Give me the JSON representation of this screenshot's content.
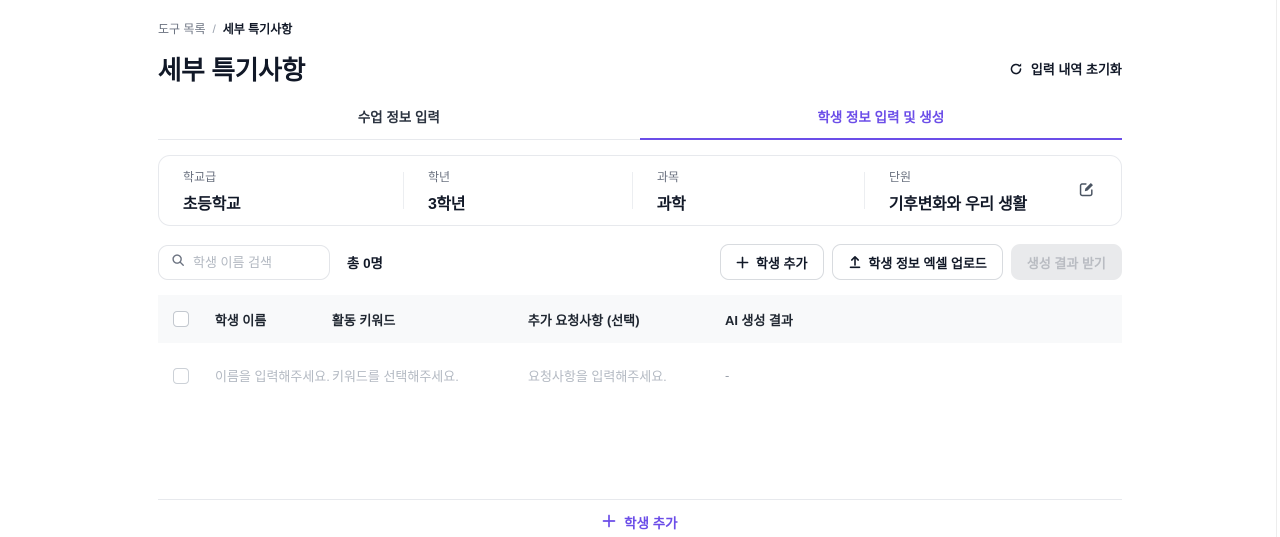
{
  "breadcrumb": {
    "parent": "도구 목록",
    "separator": "/",
    "current": "세부 특기사항"
  },
  "page_title": "세부 특기사항",
  "header": {
    "reset_label": "입력 내역 초기화",
    "reset_icon": "refresh-icon"
  },
  "tabs": [
    {
      "label": "수업 정보 입력",
      "active": false
    },
    {
      "label": "학생 정보 입력 및 생성",
      "active": true
    }
  ],
  "class_info": {
    "fields": [
      {
        "label": "학교급",
        "value": "초등학교"
      },
      {
        "label": "학년",
        "value": "3학년"
      },
      {
        "label": "과목",
        "value": "과학"
      },
      {
        "label": "단원",
        "value": "기후변화와 우리 생활"
      }
    ],
    "edit_icon": "edit-icon"
  },
  "toolbar": {
    "search_icon": "search-icon",
    "search_placeholder": "학생 이름 검색",
    "total_count": "총 0명",
    "add_student_label": "학생 추가",
    "add_student_icon": "plus-icon",
    "upload_label": "학생 정보 엑셀 업로드",
    "upload_icon": "upload-icon",
    "generate_label": "생성 결과 받기",
    "generate_disabled": true
  },
  "table": {
    "headers": [
      "학생 이름",
      "활동 키워드",
      "추가 요청사항 (선택)",
      "AI 생성 결과"
    ],
    "rows": [
      {
        "name_placeholder": "이름을 입력해주세요.",
        "keyword_placeholder": "키워드를 선택해주세요.",
        "request_placeholder": "요청사항을 입력해주세요.",
        "ai_result": "-"
      }
    ]
  },
  "footer": {
    "add_student_label": "학생 추가",
    "add_student_icon": "plus-icon"
  },
  "icons": {
    "refresh-icon": "⟳",
    "search-icon": "⌕",
    "plus-icon": "+",
    "upload-icon": "↥",
    "edit-icon": "✎"
  },
  "colors": {
    "accent_purple": "#6B4DE8",
    "text_dark": "#111827",
    "text_gray": "#6B7280",
    "placeholder_gray": "#B3B9C2",
    "border_gray": "#E7E9ED",
    "table_header_bg": "#F8F9FA",
    "disabled_bg": "#E9EAEC",
    "disabled_text": "#B9BCC2"
  }
}
